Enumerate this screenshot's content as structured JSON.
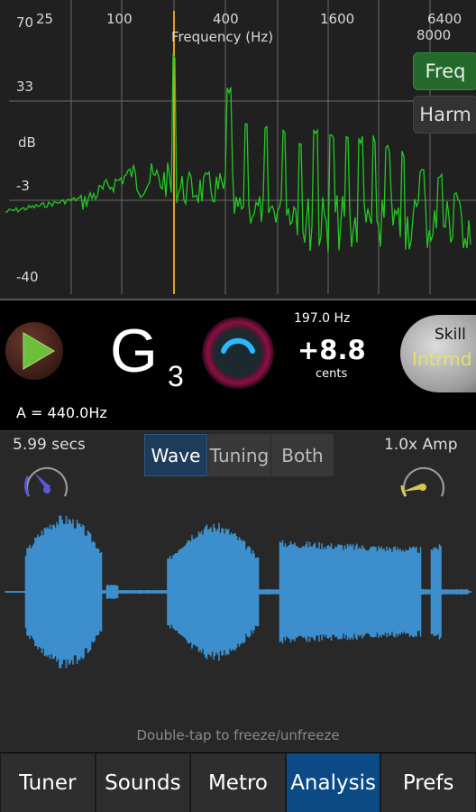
{
  "spectrum": {
    "freq_ticks": [
      "25",
      "100",
      "400",
      "1600",
      "6400"
    ],
    "freq_ticks_low": [
      "8000"
    ],
    "axis_label": "Frequency (Hz)",
    "db_ticks": [
      "70",
      "33",
      "-3",
      "-40"
    ],
    "db_label": "dB",
    "buttons": {
      "freq": "Freq",
      "harm": "Harm"
    },
    "colors": {
      "trace": "#22c922",
      "marker": "#e0a020",
      "bg": "#202020"
    }
  },
  "tuner": {
    "note": "G",
    "octave": "3",
    "frequency": "197.0 Hz",
    "cents_value": "+8.8",
    "cents_label": "cents",
    "reference": "A = 440.0Hz",
    "skill_label": "Skill",
    "skill_value": "Intrmd"
  },
  "analysis": {
    "duration": "5.99 secs",
    "amp": "1.0x Amp",
    "modes": [
      "Wave",
      "Tuning",
      "Both"
    ],
    "active_mode": "Wave",
    "hint": "Double-tap to freeze/unfreeze",
    "wave_color": "#3c8fcc"
  },
  "nav": {
    "tabs": [
      "Tuner",
      "Sounds",
      "Metro",
      "Analysis",
      "Prefs"
    ],
    "active": "Analysis"
  }
}
